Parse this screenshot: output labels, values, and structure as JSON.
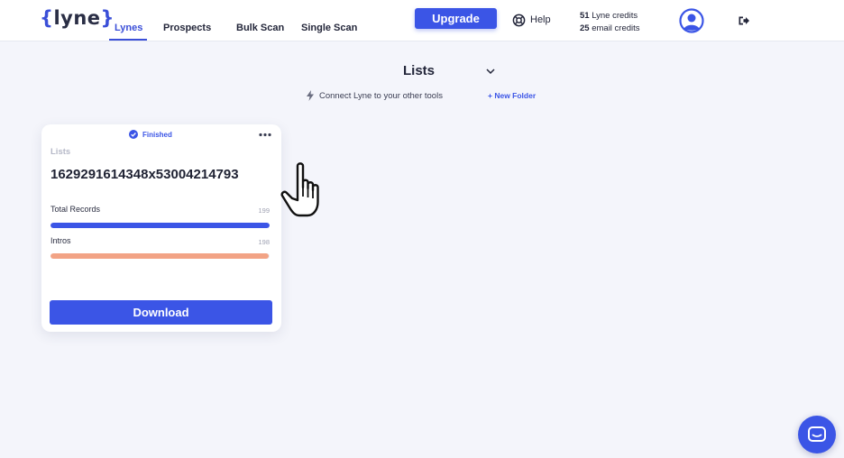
{
  "app": {
    "logo_open": "{",
    "logo_word": "lyne",
    "logo_close": "}"
  },
  "nav": {
    "items": [
      {
        "label": "Lynes",
        "active": true
      },
      {
        "label": "Prospects",
        "active": false
      },
      {
        "label": "Bulk Scan",
        "active": false
      },
      {
        "label": "Single Scan",
        "active": false
      }
    ]
  },
  "header": {
    "upgrade_label": "Upgrade",
    "help_label": "Help",
    "lyne_credits_count": "51",
    "lyne_credits_label": "Lyne credits",
    "email_credits_count": "25",
    "email_credits_label": "email credits"
  },
  "page": {
    "title": "Lists",
    "connect_text": "Connect Lyne to your other tools",
    "new_folder_label": "+ New Folder"
  },
  "card": {
    "status": "Finished",
    "category": "Lists",
    "name": "1629291614348x53004214793",
    "metrics": [
      {
        "label": "Total Records",
        "value": "199",
        "fill": 1.0,
        "color": "#3b55e6"
      },
      {
        "label": "Intros",
        "value": "198",
        "fill": 0.995,
        "color": "#f2a385"
      }
    ],
    "download_label": "Download"
  },
  "colors": {
    "accent": "#3b55e6",
    "intro_bar": "#f2a385",
    "background": "#f4f5fb"
  },
  "icons": {
    "help": "lifebuoy-icon",
    "avatar": "user-avatar-icon",
    "logout": "logout-icon",
    "status": "check-circle-icon",
    "menu": "more-horizontal-icon",
    "connect": "lightning-icon",
    "chat": "chat-icon"
  }
}
